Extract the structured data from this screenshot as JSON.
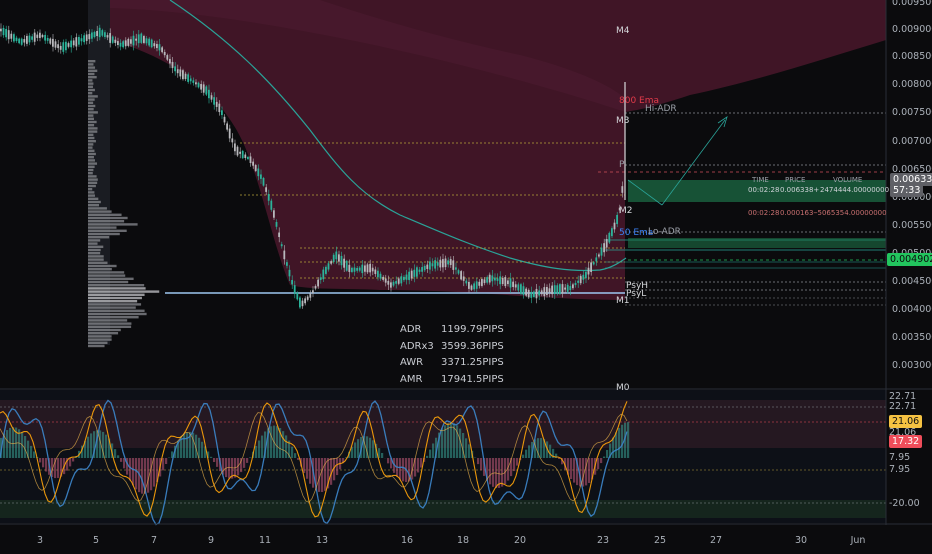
{
  "price_axis": {
    "ticks": [
      "0.009500",
      "0.009000",
      "0.008500",
      "0.008000",
      "0.007500",
      "0.007000",
      "0.006500",
      "0.006000",
      "0.005500",
      "0.005000",
      "0.004500",
      "0.004000",
      "0.003500",
      "0.003000"
    ],
    "current_price": "0.006338",
    "countdown": "57:33",
    "marker_price": "0.004902"
  },
  "osc_axis": {
    "ticks": [
      "22.71",
      "22.71",
      "21.06",
      "21.06",
      "17.32",
      "7.95",
      "7.95",
      "-20.00"
    ]
  },
  "time_axis": {
    "ticks": [
      "3",
      "5",
      "7",
      "9",
      "11",
      "13",
      "16",
      "18",
      "20",
      "23",
      "25",
      "27",
      "30",
      "Jun"
    ]
  },
  "levels": {
    "m4": "M4",
    "m3": "M3",
    "m2": "M2",
    "m1": "M1",
    "m0": "M0",
    "ema800": "800 Ema",
    "hi_adr": "Hi-ADR",
    "p": "P",
    "ema50": "50 Ema",
    "lo_adr": "Lo-ADR",
    "psyh": "PsyH",
    "psyl": "PsyL"
  },
  "trade_box": {
    "headers": [
      "TIME",
      "PRICE",
      "VOLUME"
    ],
    "row1": [
      "00:02:28",
      "0.006338+",
      "2474444.00000000"
    ],
    "row2": [
      "00:02:28",
      "0.000163-",
      "-5065354.00000000"
    ]
  },
  "adr_panel": [
    {
      "key": "ADR",
      "value": "1199.79PIPS"
    },
    {
      "key": "ADRx3",
      "value": "3599.36PIPS"
    },
    {
      "key": "AWR",
      "value": "3371.25PIPS"
    },
    {
      "key": "AMR",
      "value": "17941.5PIPS"
    }
  ],
  "colors": {
    "background": "#0b0b0d",
    "ema_cloud": "#6e1f3d",
    "ema50": "#2aa398",
    "up_candle": "#2bb39a",
    "down_candle": "#b8b8bc",
    "current_price_badge": "#5f6066",
    "marker_badge": "#22c55e",
    "osc_yellow_badge": "#f5c242",
    "osc_red_badge": "#ef4d5a",
    "osc_blue": "#3b82c4",
    "osc_orange": "#f59e0b"
  }
}
